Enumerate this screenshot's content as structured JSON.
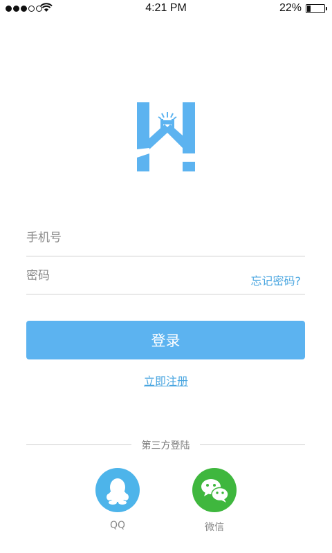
{
  "status_bar": {
    "time": "4:21 PM",
    "battery_percent": "22%",
    "battery_level": 0.22,
    "signal_bars_filled": 3,
    "signal_bars_total": 5
  },
  "colors": {
    "accent": "#5cb3f0",
    "link": "#4aa6e0",
    "qq": "#4db4ea",
    "wechat": "#3fb73e"
  },
  "logo": {
    "icon": "logo-icon"
  },
  "form": {
    "phone_placeholder": "手机号",
    "password_placeholder": "密码",
    "forgot_password": "忘记密码?",
    "login_label": "登录",
    "register_label": "立即注册"
  },
  "third_party": {
    "title": "第三方登陆",
    "providers": [
      {
        "label": "QQ",
        "icon": "qq-icon"
      },
      {
        "label": "微信",
        "icon": "wechat-icon"
      }
    ]
  }
}
